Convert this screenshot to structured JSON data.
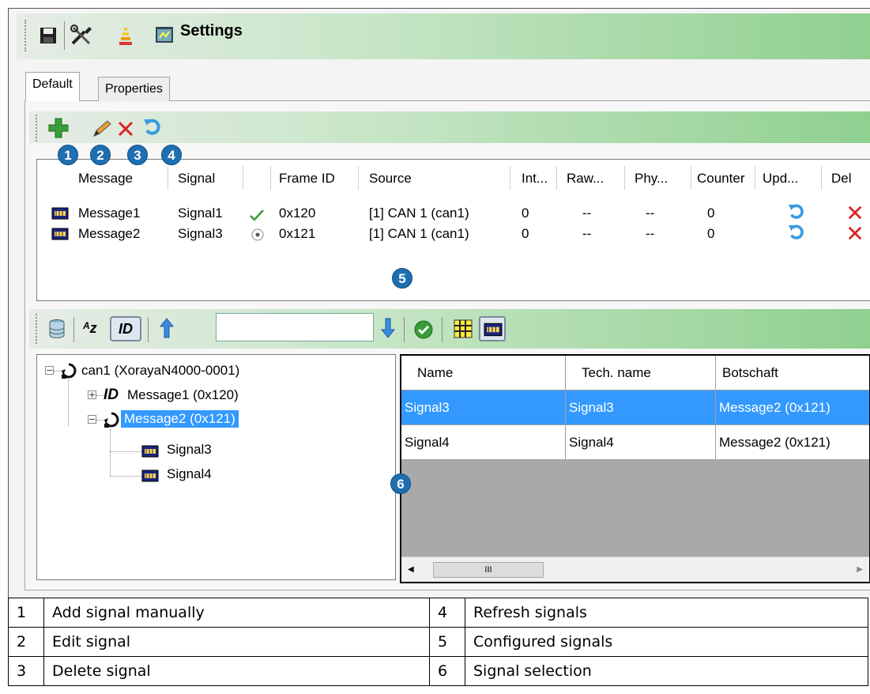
{
  "toolbar": {
    "title": "Settings",
    "icons": [
      "save-icon",
      "tools-icon",
      "levels-icon",
      "settings-window-icon"
    ]
  },
  "tabs": [
    {
      "label": "Default",
      "active": true
    },
    {
      "label": "Properties",
      "active": false
    }
  ],
  "signal_toolbar": {
    "icons": [
      "add-icon",
      "edit-pencil-icon",
      "delete-x-icon",
      "refresh-icon"
    ]
  },
  "configured": {
    "columns": [
      "Message",
      "Signal",
      "",
      "Frame ID",
      "Source",
      "Int...",
      "Raw...",
      "Phy...",
      "Counter",
      "Upd...",
      "Del"
    ],
    "rows": [
      {
        "message": "Message1",
        "signal": "Signal1",
        "state": "check",
        "frame_id": "0x120",
        "source": "[1] CAN  1 (can1)",
        "int": "0",
        "raw": "--",
        "phy": "--",
        "counter": "0"
      },
      {
        "message": "Message2",
        "signal": "Signal3",
        "state": "radio",
        "frame_id": "0x121",
        "source": "[1] CAN  1 (can1)",
        "int": "0",
        "raw": "--",
        "phy": "--",
        "counter": "0"
      }
    ]
  },
  "selection_toolbar": {
    "icons": [
      "database-icon",
      "sort-az-icon",
      "id-icon",
      "arrow-up-icon",
      "arrow-down-icon",
      "check-circle-icon",
      "grid-icon",
      "signal-icon"
    ],
    "search_value": ""
  },
  "tree": {
    "root": "can1 (XorayaN4000-0001)",
    "children": [
      {
        "label": "Message1 (0x120)",
        "expander": "+"
      },
      {
        "label": "Message2 (0x121)",
        "expander": "−",
        "selected": true
      }
    ],
    "signals": [
      "Signal3",
      "Signal4"
    ]
  },
  "grid": {
    "columns": [
      "Name",
      "Tech. name",
      "Botschaft"
    ],
    "rows": [
      {
        "name": "Signal3",
        "tech": "Signal3",
        "message": "Message2 (0x121)",
        "selected": true
      },
      {
        "name": "Signal4",
        "tech": "Signal4",
        "message": "Message2 (0x121)",
        "selected": false
      }
    ],
    "scroll_glyph": "III"
  },
  "badges": [
    "1",
    "2",
    "3",
    "4",
    "5",
    "6"
  ],
  "legend": [
    {
      "n1": "1",
      "t1": "Add signal manually",
      "n2": "4",
      "t2": "Refresh signals"
    },
    {
      "n1": "2",
      "t1": "Edit signal",
      "n2": "5",
      "t2": "Configured signals"
    },
    {
      "n1": "3",
      "t1": "Delete signal",
      "n2": "6",
      "t2": "Signal selection"
    }
  ],
  "colors": {
    "accent": "#1f6fb0",
    "selection": "#3399ff",
    "toolbar_green": "#8fd08f"
  }
}
